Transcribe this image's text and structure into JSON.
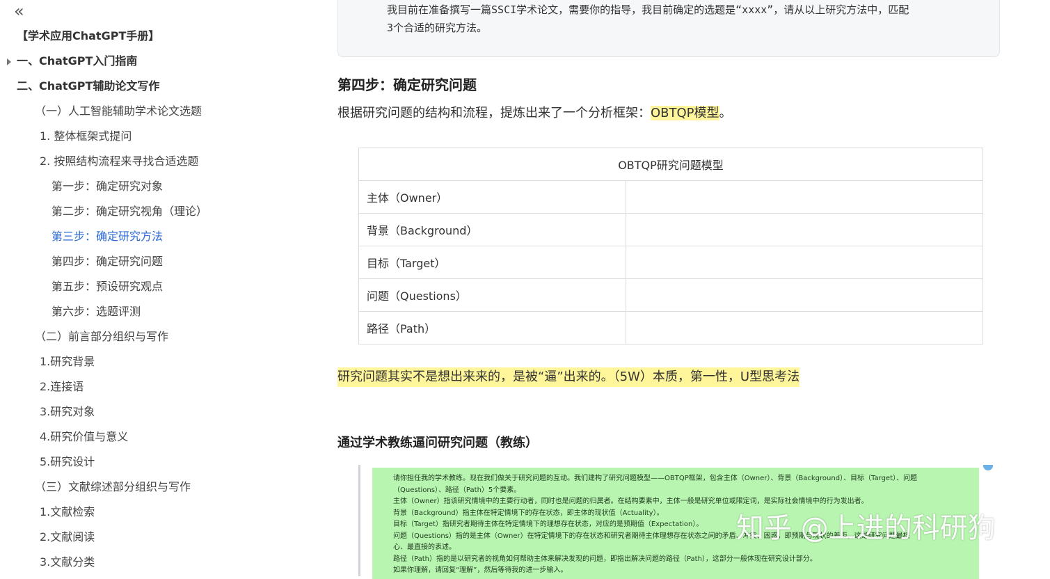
{
  "sidebar": {
    "collapse_label": "«",
    "items": [
      {
        "label": "【学术应用ChatGPT手册】",
        "level": 0
      },
      {
        "label": "一、ChatGPT入门指南",
        "level": 0,
        "expandable": true
      },
      {
        "label": "二、ChatGPT辅助论文写作",
        "level": 0
      },
      {
        "label": "（一）人工智能辅助学术论文选题",
        "level": 1
      },
      {
        "label": "1. 整体框架式提问",
        "level": 2
      },
      {
        "label": "2. 按照结构流程来寻找合适选题",
        "level": 2
      },
      {
        "label": "第一步：确定研究对象",
        "level": 3
      },
      {
        "label": "第二步：确定研究视角（理论）",
        "level": 3
      },
      {
        "label": "第三步：确定研究方法",
        "level": 3,
        "active": true
      },
      {
        "label": "第四步：确定研究问题",
        "level": 3
      },
      {
        "label": "第五步：预设研究观点",
        "level": 3
      },
      {
        "label": "第六步：选题评测",
        "level": 3
      },
      {
        "label": "（二）前言部分组织与写作",
        "level": 1
      },
      {
        "label": "1.研究背景",
        "level": 2
      },
      {
        "label": "2.连接语",
        "level": 2
      },
      {
        "label": "3.研究对象",
        "level": 2
      },
      {
        "label": "4.研究价值与意义",
        "level": 2
      },
      {
        "label": "5.研究设计",
        "level": 2
      },
      {
        "label": "（三）文献综述部分组织与写作",
        "level": 1
      },
      {
        "label": "1.文献检索",
        "level": 2
      },
      {
        "label": "2.文献阅读",
        "level": 2
      },
      {
        "label": "3.文献分类",
        "level": 2
      }
    ]
  },
  "main": {
    "quote_lines": [
      "我目前在准备撰写一篇SSCI学术论文，需要你的指导，我目前确定的选题是“xxxx”，请从以上研究方法中，匹配",
      "3个合适的研究方法。"
    ],
    "step_heading": "第四步：确定研究问题",
    "para1_prefix": "根据研究问题的结构和流程，提炼出来了一个分析框架：",
    "para1_highlight": "OBTQP模型",
    "para1_suffix": "。",
    "table": {
      "caption": "OBTQP研究问题模型",
      "rows": [
        "主体（Owner）",
        "背景（Background）",
        "目标（Target）",
        "问题（Questions）",
        "路径（Path）"
      ]
    },
    "para2": "研究问题其实不是想出来来的，是被“逼”出来的。（5W）本质，第一性，U型思考法",
    "coach_heading": "通过学术教练逼问研究问题（教练）",
    "image_lines": [
      "请你担任我的学术教练。现在我们做关于研究问题的互动。我们建构了研究问题模型——OBTQP框架，包含主体（Owner）、背景（Background）、目标（Target）、问题",
      "（Questions）、路径（Path）5个要素。",
      "主体（Owner）指该研究情境中的主要行动者，同时也是问题的归属者。在结构要素中，主体一般是研究单位或限定词，是实际社会情境中的行为发出者。",
      "背景（Background）指主体在特定情境下的存在状态，即主体的现状值（Actuality）。",
      "目标（Target）指研究者期待主体在特定情境下的理想存在状态，对应的是预期值（Expectation）。",
      "问题（Questions）指的是主体（Owner）在特定情境下的存在状态和研究者期待主体理想存在状态之间的矛盾、冲突、困惑，即预期与现状的差距，这是研究问题最核",
      "心、最直接的表述。",
      "路径（Path）指的是以研究者的视角如何帮助主体来解决发现的问题，即指出解决问题的路径（Path），这部分一般体现在研究设计部分。",
      "如果你理解，请回复“理解”，然后等待我的进一步输入。"
    ]
  },
  "watermark": {
    "big_text": "知乎 @上进的科研狗"
  }
}
